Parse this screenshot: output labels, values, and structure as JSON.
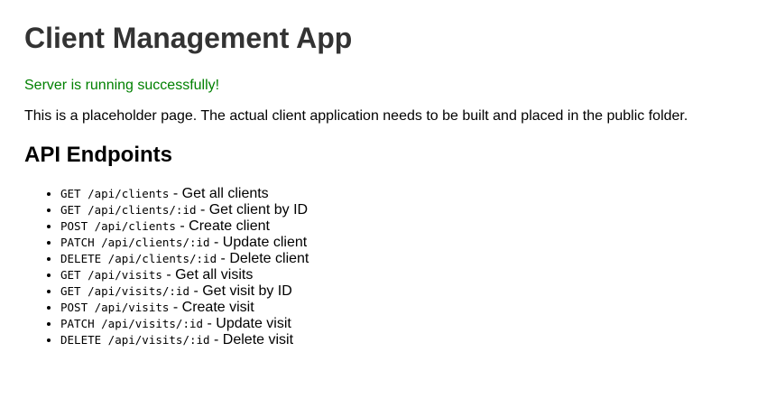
{
  "page": {
    "title": "Client Management App",
    "status": "Server is running successfully!",
    "description": "This is a placeholder page. The actual client application needs to be built and placed in the public folder.",
    "section_title": "API Endpoints"
  },
  "colors": {
    "title": "#333333",
    "status": "#008000",
    "text": "#000000",
    "background": "#ffffff"
  },
  "endpoints": [
    {
      "method_path": "GET /api/clients",
      "desc": " - Get all clients"
    },
    {
      "method_path": "GET /api/clients/:id",
      "desc": " - Get client by ID"
    },
    {
      "method_path": "POST /api/clients",
      "desc": " - Create client"
    },
    {
      "method_path": "PATCH /api/clients/:id",
      "desc": " - Update client"
    },
    {
      "method_path": "DELETE /api/clients/:id",
      "desc": " - Delete client"
    },
    {
      "method_path": "GET /api/visits",
      "desc": " - Get all visits"
    },
    {
      "method_path": "GET /api/visits/:id",
      "desc": " - Get visit by ID"
    },
    {
      "method_path": "POST /api/visits",
      "desc": " - Create visit"
    },
    {
      "method_path": "PATCH /api/visits/:id",
      "desc": " - Update visit"
    },
    {
      "method_path": "DELETE /api/visits/:id",
      "desc": " - Delete visit"
    }
  ]
}
